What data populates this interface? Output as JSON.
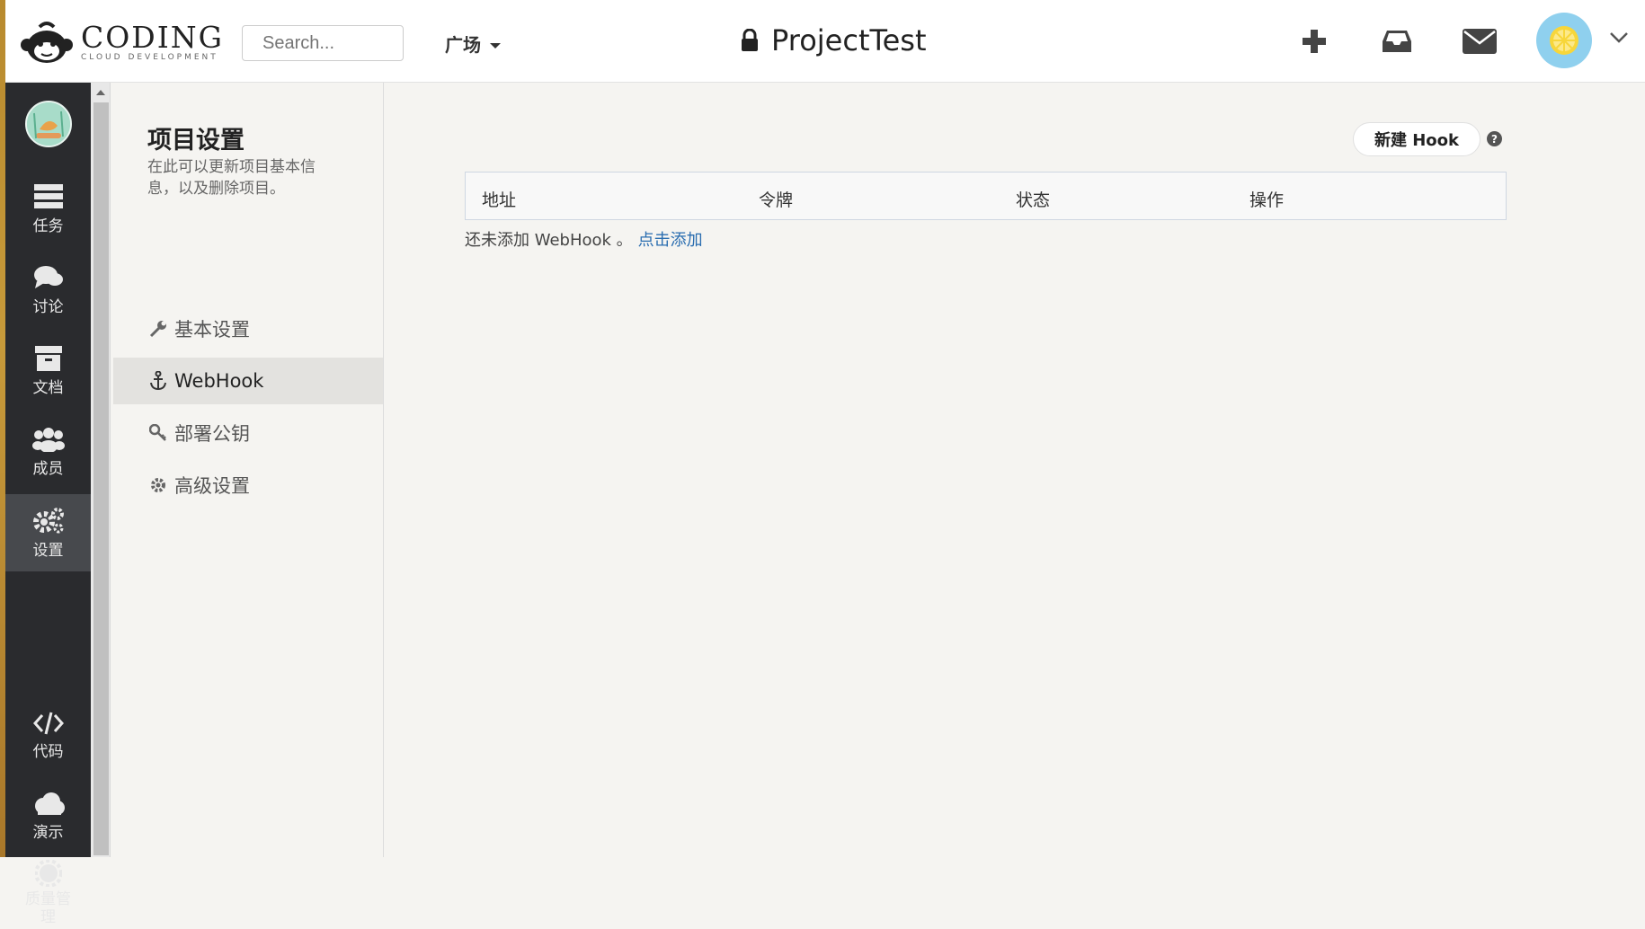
{
  "header": {
    "logo_word": "CODING",
    "logo_sub": "CLOUD DEVELOPMENT",
    "search_placeholder": "Search...",
    "plaza_label": "广场",
    "project_title": "ProjectTest"
  },
  "sidebar": {
    "items": [
      {
        "label": "任务",
        "icon": "tasks-icon"
      },
      {
        "label": "讨论",
        "icon": "discussion-icon"
      },
      {
        "label": "文档",
        "icon": "docs-icon"
      },
      {
        "label": "成员",
        "icon": "members-icon"
      },
      {
        "label": "设置",
        "icon": "settings-icon",
        "active": true
      },
      {
        "label": "代码",
        "icon": "code-icon"
      },
      {
        "label": "演示",
        "icon": "cloud-icon"
      },
      {
        "label": "质量管理",
        "icon": "quality-icon"
      }
    ]
  },
  "settings": {
    "title": "项目设置",
    "desc": "在此可以更新项目基本信息，以及删除项目。",
    "nav": [
      {
        "label": "基本设置",
        "icon": "wrench-icon"
      },
      {
        "label": "WebHook",
        "icon": "anchor-icon",
        "active": true
      },
      {
        "label": "部署公钥",
        "icon": "key-icon"
      },
      {
        "label": "高级设置",
        "icon": "gear-icon"
      }
    ]
  },
  "main": {
    "new_hook_label": "新建 Hook",
    "columns": [
      "地址",
      "令牌",
      "状态",
      "操作"
    ],
    "empty_text": "还未添加 WebHook 。",
    "empty_link": "点击添加"
  }
}
